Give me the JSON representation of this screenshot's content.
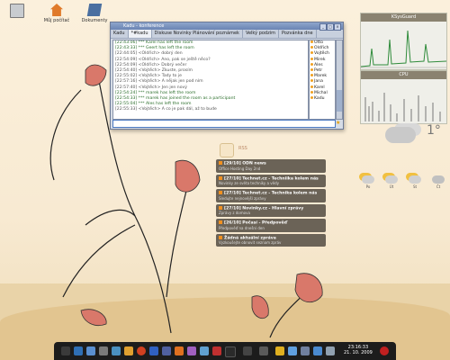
{
  "desktop": {
    "icons": [
      {
        "label": "",
        "icon": "trash-icon"
      },
      {
        "label": "Můj počítač",
        "icon": "home-icon"
      },
      {
        "label": "Dokumenty",
        "icon": "documents-icon"
      }
    ]
  },
  "chat_window": {
    "title": "Kadu - konference",
    "tabs": [
      "Kadu",
      "*#kadu",
      "Diskuse Novinky Plánování poznámek",
      "Velký podzim",
      "Pozvánka dne"
    ],
    "log": [
      "[22:43:06] *** Karel has left the room",
      "[22:43:33] *** Geert has left the room",
      "[22:44:05] <Oldřich> dobrý den",
      "[22:54:09] <Oldřich> Ano, pak se ještě něco?",
      "[22:54:09] <Oldřich> Dobrý večer",
      "[22:54:40] <Vojtěch> Zkuste, prosím",
      "[22:55:02] <Vojtěch> Tady to je",
      "[22:57:16] <Vojtěch> A nějak jen pod ním",
      "[22:57:40] <Vojtěch> Jen jen nový",
      "[22:54:24] *** marek has left the room",
      "[22:54:33] *** marek has joined the room as a participant",
      "[22:55:04] *** Ales has left the room",
      "[22:55:33] <Vojtěch> A co je pak dál, až to bude"
    ],
    "users": [
      "Otto",
      "Oldřich",
      "Vojtěch",
      "Mirek",
      "Ales",
      "Petr",
      "Marek",
      "Jana",
      "Karel",
      "Michal",
      "Kadu"
    ]
  },
  "monitors": [
    {
      "title": "KSysGuard",
      "kind": "cpu"
    },
    {
      "title": "CPU",
      "kind": "net"
    }
  ],
  "weather": {
    "temperature": "1°",
    "forecast_days": [
      "Po",
      "Út",
      "St",
      "Čt"
    ]
  },
  "news": {
    "header": "RSS",
    "items": [
      {
        "title": "[29/10] ODN news",
        "desc": "Office Hosting Day 2nd"
      },
      {
        "title": "[27/10] Technet.cz - Techniika kolem nás",
        "desc": "Novinky ze světa techniky a vědy"
      },
      {
        "title": "[27/10] Technet.cz - Technika kolem nás",
        "desc": "Sledujte nejnovější zprávy"
      },
      {
        "title": "[27/10] Novinky.cz - Hlavní zprávy",
        "desc": "Zprávy z domova"
      },
      {
        "title": "[26/10] Počasí - Předpověď",
        "desc": "Předpověď na dnešní den"
      },
      {
        "title": "Žádná aktuální zpráva",
        "desc": "Vyzkoušejte obnovit seznam zpráv"
      }
    ]
  },
  "taskbar": {
    "clock_time": "23:16:33",
    "clock_date": "21. 10. 2009"
  },
  "colors": {
    "window_title": "#6a84b3",
    "panel": "#1c1c1c",
    "news_item": "#6b6357",
    "flower": "#d9786a"
  }
}
